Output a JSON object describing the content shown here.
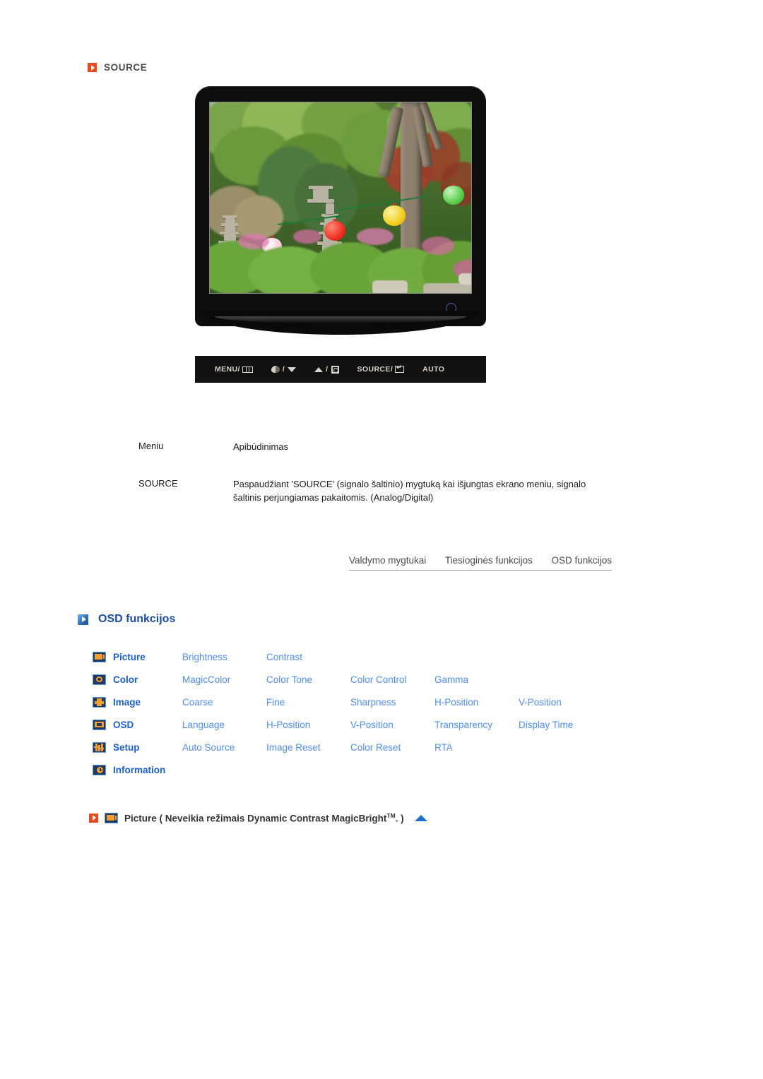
{
  "source_section": {
    "heading": "SOURCE",
    "icon": "orange-arrow-icon"
  },
  "monitor": {
    "power_button": "power-indicator",
    "controls": [
      {
        "label": "MENU/",
        "glyph": "menu-icon"
      },
      {
        "label": "",
        "glyph": "contrast-icon",
        "sep": "/",
        "glyph2": "triangle-down-icon"
      },
      {
        "label": "",
        "glyph": "triangle-up-icon",
        "sep": "/",
        "glyph2": "brightness-sun-icon"
      },
      {
        "label": "SOURCE/",
        "glyph": "enter-icon"
      },
      {
        "label": "AUTO",
        "glyph": ""
      }
    ]
  },
  "desc_table": {
    "header": {
      "menu": "Meniu",
      "description": "Apibūdinimas"
    },
    "rows": [
      {
        "menu": "SOURCE",
        "description": "Paspaudžiant 'SOURCE' (signalo šaltinio) mygtuką kai išjungtas ekrano meniu, signalo šaltinis perjungiamas pakaitomis. (Analog/Digital)"
      }
    ]
  },
  "tabs": [
    {
      "label": "Valdymo mygtukai"
    },
    {
      "label": "Tiesioginės funkcijos"
    },
    {
      "label": "OSD funkcijos"
    }
  ],
  "osd_section": {
    "heading": "OSD funkcijos",
    "rows": [
      {
        "icon": "picture-icon",
        "category": "Picture",
        "items": [
          "Brightness",
          "Contrast"
        ]
      },
      {
        "icon": "color-icon",
        "category": "Color",
        "items": [
          "MagicColor",
          "Color Tone",
          "Color Control",
          "Gamma"
        ]
      },
      {
        "icon": "image-icon",
        "category": "Image",
        "items": [
          "Coarse",
          "Fine",
          "Sharpness",
          "H-Position",
          "V-Position"
        ]
      },
      {
        "icon": "osd-icon",
        "category": "OSD",
        "items": [
          "Language",
          "H-Position",
          "V-Position",
          "Transparency",
          "Display Time"
        ]
      },
      {
        "icon": "setup-icon",
        "category": "Setup",
        "items": [
          "Auto Source",
          "Image Reset",
          "Color Reset",
          "RTA"
        ]
      },
      {
        "icon": "information-icon",
        "category": "Information",
        "items": []
      }
    ]
  },
  "bottom_section": {
    "arrow_icon": "orange-arrow-icon",
    "menu_icon": "picture-icon",
    "title_pre": "Picture ( Neveikia režimais Dynamic Contrast MagicBright",
    "title_sup": "TM",
    "title_post": ". )",
    "back_to_top": "top-triangle-icon"
  },
  "colors": {
    "orange_accent": "#e8491e",
    "blue_heading": "#1b4f9c",
    "category_blue": "#1b5fd0",
    "item_blue": "#4f8ff7",
    "text_dark": "#1a1a1a",
    "bezel_black": "#0d0d0d"
  }
}
